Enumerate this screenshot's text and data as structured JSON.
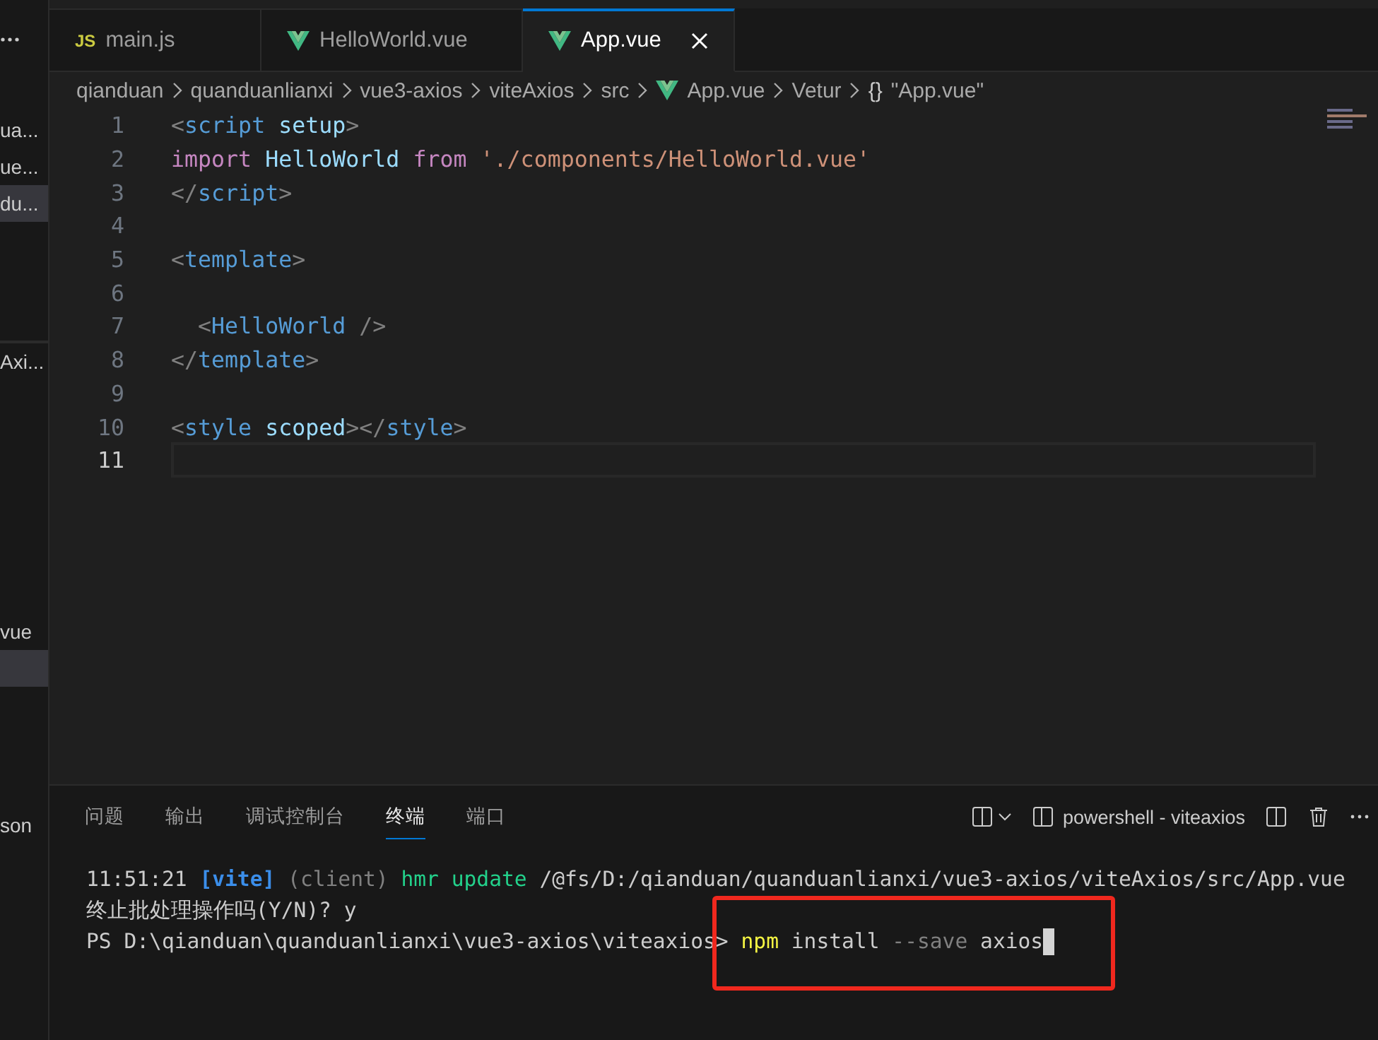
{
  "sidebar": {
    "items": [
      {
        "label": "ua...",
        "selected": false
      },
      {
        "label": "ue...",
        "selected": false
      },
      {
        "label": "du...",
        "selected": true
      },
      {
        "label": "Axi...",
        "selected": false
      },
      {
        "label": "vue",
        "selected": false
      },
      {
        "selected": true
      },
      {
        "label": "son",
        "selected": false
      }
    ]
  },
  "tabs": [
    {
      "label": "main.js",
      "kind": "js",
      "badge": "JS",
      "selected": false
    },
    {
      "label": "HelloWorld.vue",
      "kind": "vue",
      "selected": false
    },
    {
      "label": "App.vue",
      "kind": "vue",
      "selected": true
    }
  ],
  "breadcrumb": [
    {
      "label": "qianduan",
      "kind": "folder"
    },
    {
      "label": "quanduanlianxi",
      "kind": "folder"
    },
    {
      "label": "vue3-axios",
      "kind": "folder"
    },
    {
      "label": "viteAxios",
      "kind": "folder"
    },
    {
      "label": "src",
      "kind": "folder"
    },
    {
      "label": "App.vue",
      "kind": "vue"
    },
    {
      "label": "Vetur",
      "kind": "folder"
    },
    {
      "label": "\"App.vue\"",
      "kind": "symbol",
      "symbol": "{}"
    }
  ],
  "editor": {
    "lines": [
      {
        "number": "1",
        "current": false,
        "tokens": [
          {
            "t": "<",
            "kind": "punct"
          },
          {
            "t": "script",
            "kind": "tag"
          },
          {
            "t": " setup",
            "kind": "attr"
          },
          {
            "t": ">",
            "kind": "punct"
          }
        ]
      },
      {
        "number": "2",
        "current": false,
        "tokens": [
          {
            "t": "import",
            "kind": "keyword"
          },
          {
            "t": " HelloWorld ",
            "kind": "ident"
          },
          {
            "t": "from",
            "kind": "keyword"
          },
          {
            "t": " './components/HelloWorld.vue'",
            "kind": "string"
          }
        ]
      },
      {
        "number": "3",
        "current": false,
        "tokens": [
          {
            "t": "</",
            "kind": "punct"
          },
          {
            "t": "script",
            "kind": "tag"
          },
          {
            "t": ">",
            "kind": "punct"
          }
        ]
      },
      {
        "number": "4",
        "current": false
      },
      {
        "number": "5",
        "current": false,
        "tokens": [
          {
            "t": "<",
            "kind": "punct"
          },
          {
            "t": "template",
            "kind": "tag"
          },
          {
            "t": ">",
            "kind": "punct"
          }
        ]
      },
      {
        "number": "6",
        "current": false
      },
      {
        "number": "7",
        "current": false,
        "tokens": [
          {
            "t": "  <",
            "kind": "punct"
          },
          {
            "t": "HelloWorld",
            "kind": "tag"
          },
          {
            "t": " />",
            "kind": "punct"
          }
        ]
      },
      {
        "number": "8",
        "current": false,
        "tokens": [
          {
            "t": "</",
            "kind": "punct"
          },
          {
            "t": "template",
            "kind": "tag"
          },
          {
            "t": ">",
            "kind": "punct"
          }
        ]
      },
      {
        "number": "9",
        "current": false
      },
      {
        "number": "10",
        "current": false,
        "tokens": [
          {
            "t": "<",
            "kind": "punct"
          },
          {
            "t": "style",
            "kind": "tag"
          },
          {
            "t": " scoped",
            "kind": "attr"
          },
          {
            "t": "></",
            "kind": "punct"
          },
          {
            "t": "style",
            "kind": "tag"
          },
          {
            "t": ">",
            "kind": "punct"
          }
        ]
      },
      {
        "number": "11",
        "current": true
      }
    ]
  },
  "panel": {
    "tabs": [
      {
        "label": "问题",
        "selected": false
      },
      {
        "label": "输出",
        "selected": false
      },
      {
        "label": "调试控制台",
        "selected": false
      },
      {
        "label": "终端",
        "selected": true
      },
      {
        "label": "端口",
        "selected": false
      }
    ],
    "terminal_name": "powershell - viteaxios",
    "terminal": [
      [
        {
          "t": "11:51:21 ",
          "kind": "plain"
        },
        {
          "t": "[vite]",
          "kind": "cyan"
        },
        {
          "t": " (client) ",
          "kind": "dim"
        },
        {
          "t": "hmr update ",
          "kind": "green"
        },
        {
          "t": "/@fs/D:/qianduan/quanduanlianxi/vue3-axios/viteAxios/src/App.vue",
          "kind": "plain"
        }
      ],
      [
        {
          "t": "终止批处理操作吗(Y/N)? y",
          "kind": "plain"
        }
      ],
      [
        {
          "t": "PS D:\\qianduan\\quanduanlianxi\\vue3-axios\\viteaxios> ",
          "kind": "plain"
        },
        {
          "t": "npm",
          "kind": "yellow"
        },
        {
          "t": " install ",
          "kind": "plain"
        },
        {
          "t": "--save",
          "kind": "dim"
        },
        {
          "t": " axios",
          "kind": "plain"
        }
      ]
    ],
    "highlight": {
      "kind": "rectangle"
    }
  }
}
